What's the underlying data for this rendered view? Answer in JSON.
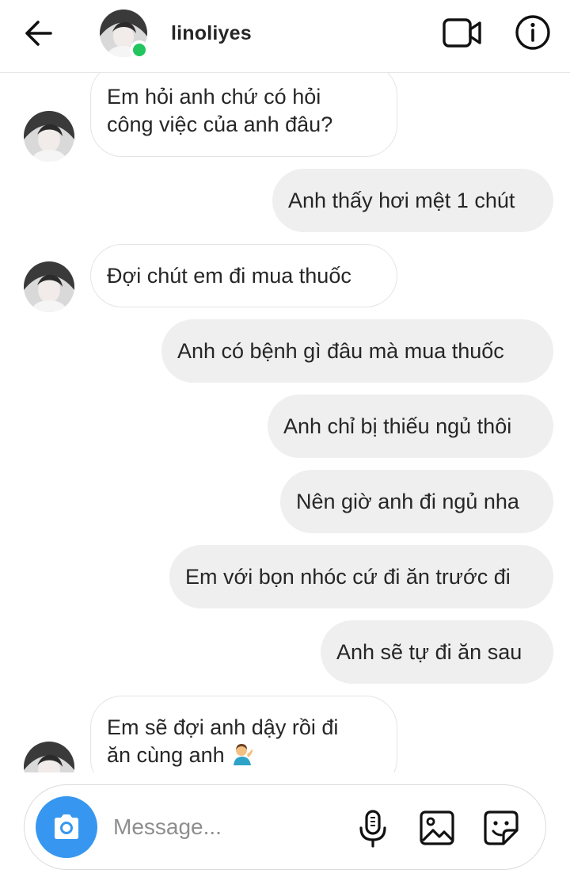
{
  "header": {
    "username": "linoliyes",
    "online": true,
    "icons": {
      "back": "back-arrow-icon",
      "video": "video-call-icon",
      "info": "info-icon"
    }
  },
  "messages": [
    {
      "from": "them",
      "text": "Em hỏi anh chứ có hỏi công việc của anh đâu?",
      "lines": [
        "Em hỏi anh chứ có hỏi",
        "công việc của anh đâu?"
      ]
    },
    {
      "from": "me",
      "text": "Anh thấy hơi mệt 1 chút"
    },
    {
      "from": "them",
      "text": "Đợi chút em đi mua thuốc"
    },
    {
      "from": "me",
      "text": "Anh có bệnh gì đâu mà mua thuốc"
    },
    {
      "from": "me",
      "text": "Anh chỉ bị thiếu ngủ thôi"
    },
    {
      "from": "me",
      "text": "Nên giờ anh đi ngủ nha"
    },
    {
      "from": "me",
      "text": "Em với bọn nhóc cứ đi ăn trước đi"
    },
    {
      "from": "me",
      "text": "Anh sẽ tự đi ăn sau"
    },
    {
      "from": "them",
      "text": "Em sẽ đợi anh dậy rồi đi ăn cùng anh",
      "lines": [
        "Em sẽ đợi anh dậy rồi đi",
        "ăn cùng anh"
      ],
      "emoji": "person-tipping-hand-emoji"
    }
  ],
  "composer": {
    "placeholder": "Message...",
    "value": "",
    "icons": {
      "camera": "camera-icon",
      "mic": "microphone-icon",
      "gallery": "gallery-icon",
      "sticker": "sticker-icon"
    }
  },
  "colors": {
    "accent": "#3797f0",
    "online": "#22c55e",
    "outgoing_bubble": "#efefef",
    "incoming_border": "#e4e4e4"
  }
}
